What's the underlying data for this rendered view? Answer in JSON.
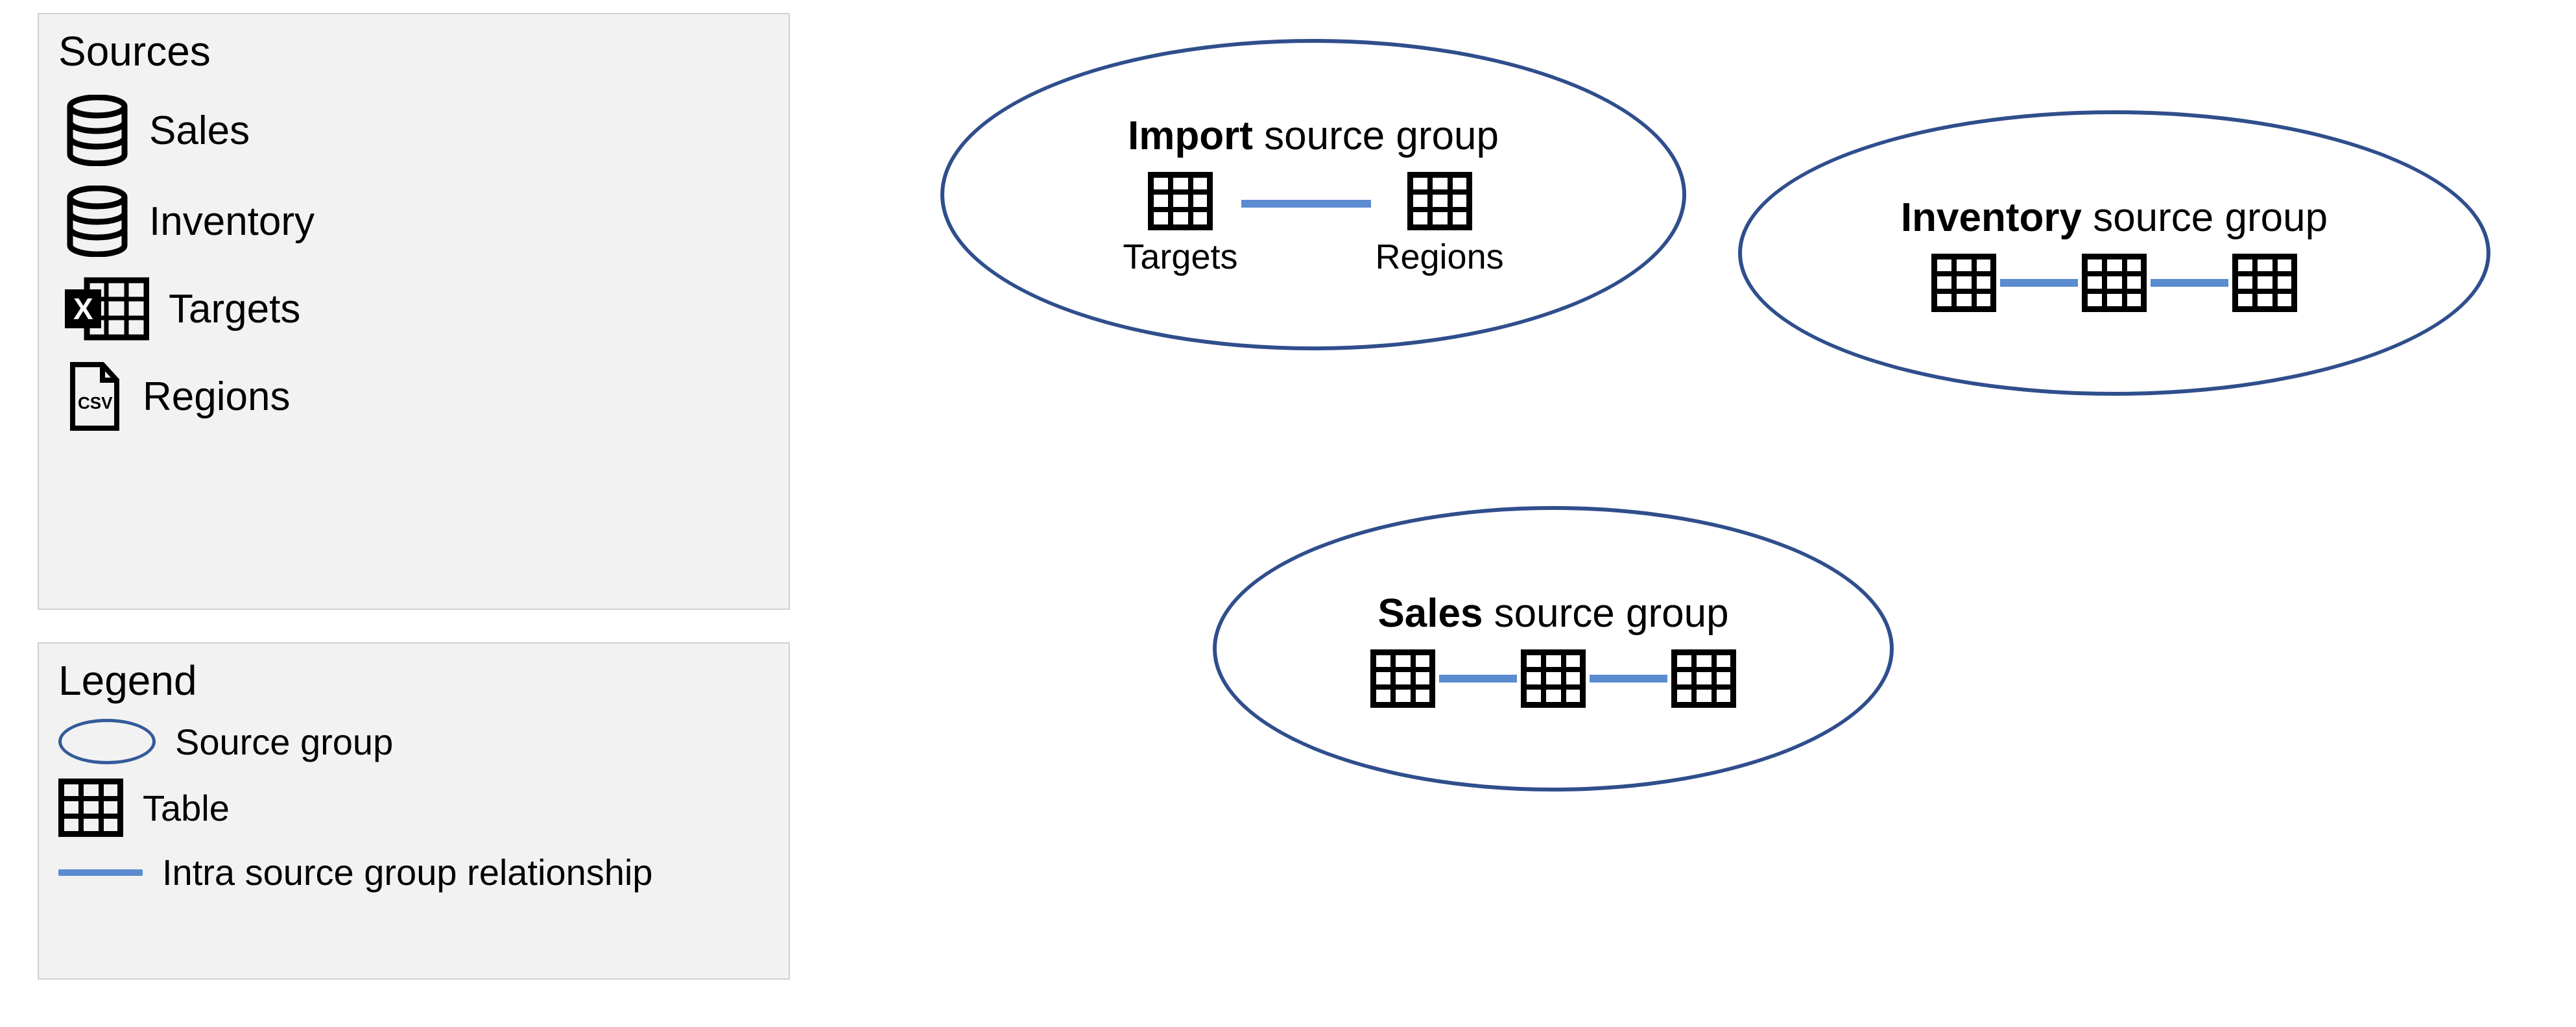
{
  "sources": {
    "title": "Sources",
    "items": [
      {
        "type": "db",
        "label": "Sales"
      },
      {
        "type": "db",
        "label": "Inventory"
      },
      {
        "type": "excel",
        "label": "Targets"
      },
      {
        "type": "csv",
        "label": "Regions"
      }
    ]
  },
  "legend": {
    "title": "Legend",
    "items": [
      {
        "icon": "ellipse",
        "label": "Source group"
      },
      {
        "icon": "table",
        "label": "Table"
      },
      {
        "icon": "line",
        "label": "Intra source group relationship"
      }
    ]
  },
  "groups": {
    "import": {
      "title_bold": "Import",
      "title_rest": " source group",
      "tables": [
        "Targets",
        "Regions"
      ]
    },
    "inventory": {
      "title_bold": "Inventory",
      "title_rest": " source group",
      "table_count": 3
    },
    "sales": {
      "title_bold": "Sales",
      "title_rest": " source group",
      "table_count": 3
    }
  }
}
